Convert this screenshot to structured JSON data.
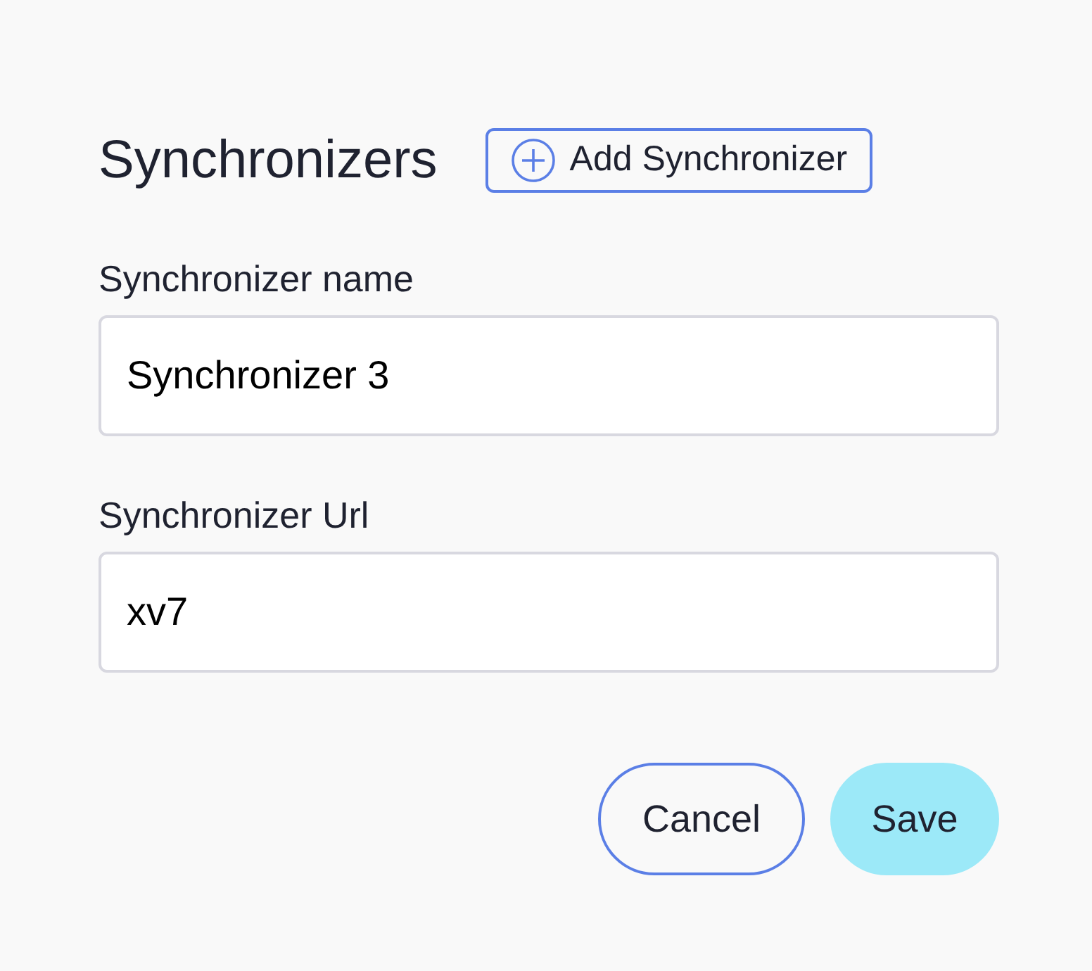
{
  "title": "Synchronizers",
  "add_button": {
    "label": "Add Synchronizer"
  },
  "fields": [
    {
      "label": "Synchronizer name",
      "value": "Synchronizer 3"
    },
    {
      "label": "Synchronizer Url",
      "value": "xv7"
    }
  ],
  "buttons": [
    {
      "label": "Cancel",
      "kind": "secondary"
    },
    {
      "label": "Save",
      "kind": "primary"
    }
  ]
}
